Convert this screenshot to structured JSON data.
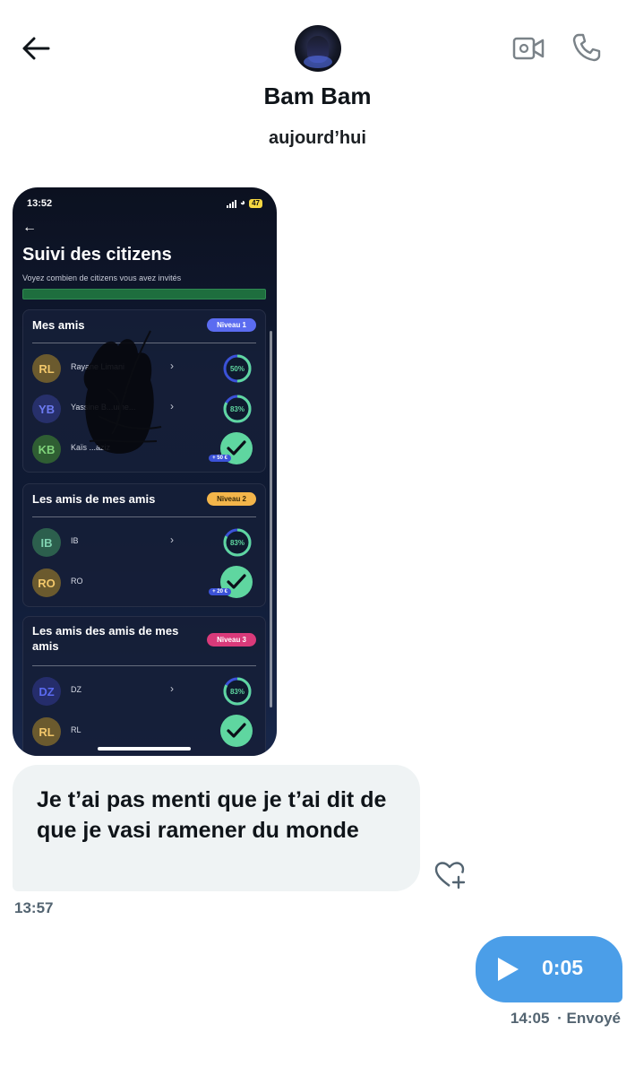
{
  "header": {
    "contact_name": "Bam Bam",
    "date_label": "aujourd’hui"
  },
  "attachment": {
    "status_time": "13:52",
    "battery": "47",
    "title": "Suivi des citizens",
    "subtitle": "Voyez combien de citizens vous avez invités",
    "cards": [
      {
        "title": "Mes amis",
        "badge": "Niveau 1",
        "badge_color": "#5b6cf0",
        "rows": [
          {
            "initials": "RL",
            "name": "Rayane Limani",
            "status": "50%",
            "progress": 0.5,
            "avatar_bg": "#6b5a2e",
            "avatar_fg": "#f2c76a"
          },
          {
            "initials": "YB",
            "name": "Yassine B...ume...",
            "status": "83%",
            "progress": 0.83,
            "avatar_bg": "#27306b",
            "avatar_fg": "#6d7bf2"
          },
          {
            "initials": "KB",
            "name": "Kaïs ...aziz",
            "status": "done",
            "bonus": "+ 50 €",
            "avatar_bg": "#2f5e33",
            "avatar_fg": "#7fd27a"
          }
        ]
      },
      {
        "title": "Les amis de mes amis",
        "badge": "Niveau 2",
        "badge_color": "#f3b54a",
        "rows": [
          {
            "initials": "IB",
            "name": "IB",
            "status": "83%",
            "progress": 0.83,
            "avatar_bg": "#2c5f4d",
            "avatar_fg": "#7fd2b0"
          },
          {
            "initials": "RO",
            "name": "RO",
            "status": "done",
            "bonus": "+ 20 €",
            "avatar_bg": "#6b5a2e",
            "avatar_fg": "#f2c76a"
          }
        ]
      },
      {
        "title": "Les amis des amis de mes amis",
        "badge": "Niveau 3",
        "badge_color": "#d93a7a",
        "rows": [
          {
            "initials": "DZ",
            "name": "DZ",
            "status": "83%",
            "progress": 0.83,
            "avatar_bg": "#252d6b",
            "avatar_fg": "#5a6af0"
          },
          {
            "initials": "RL",
            "name": "RL",
            "status": "done",
            "avatar_bg": "#6b5a2e",
            "avatar_fg": "#f2c76a"
          }
        ]
      }
    ]
  },
  "messages": [
    {
      "direction": "in",
      "text": "Je t’ai pas menti que je t’ai dit de que je vasi ramener du monde",
      "time": "13:57"
    },
    {
      "direction": "out",
      "type": "voice",
      "duration": "0:05",
      "time": "14:05",
      "status": "· Envoyé"
    }
  ],
  "colors": {
    "incoming_bubble": "#eff3f4",
    "outgoing_bubble": "#4b9ee8",
    "meta_text": "#536471",
    "progress_ring": "#5fd6a0",
    "progress_track": "#3b52d8"
  },
  "icons": {
    "back": "arrow-left-icon",
    "video": "video-camera-icon",
    "call": "phone-icon",
    "react": "heart-plus-icon",
    "play": "play-icon"
  }
}
